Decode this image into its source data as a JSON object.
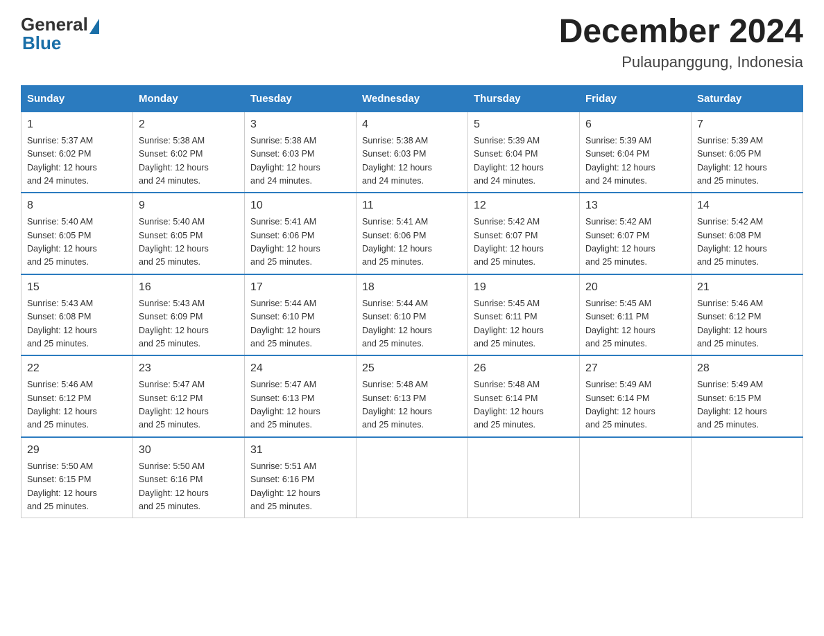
{
  "header": {
    "logo_general": "General",
    "logo_blue": "Blue",
    "month_title": "December 2024",
    "location": "Pulaupanggung, Indonesia"
  },
  "days_of_week": [
    "Sunday",
    "Monday",
    "Tuesday",
    "Wednesday",
    "Thursday",
    "Friday",
    "Saturday"
  ],
  "weeks": [
    [
      {
        "day": "1",
        "sunrise": "5:37 AM",
        "sunset": "6:02 PM",
        "daylight": "12 hours and 24 minutes."
      },
      {
        "day": "2",
        "sunrise": "5:38 AM",
        "sunset": "6:02 PM",
        "daylight": "12 hours and 24 minutes."
      },
      {
        "day": "3",
        "sunrise": "5:38 AM",
        "sunset": "6:03 PM",
        "daylight": "12 hours and 24 minutes."
      },
      {
        "day": "4",
        "sunrise": "5:38 AM",
        "sunset": "6:03 PM",
        "daylight": "12 hours and 24 minutes."
      },
      {
        "day": "5",
        "sunrise": "5:39 AM",
        "sunset": "6:04 PM",
        "daylight": "12 hours and 24 minutes."
      },
      {
        "day": "6",
        "sunrise": "5:39 AM",
        "sunset": "6:04 PM",
        "daylight": "12 hours and 24 minutes."
      },
      {
        "day": "7",
        "sunrise": "5:39 AM",
        "sunset": "6:05 PM",
        "daylight": "12 hours and 25 minutes."
      }
    ],
    [
      {
        "day": "8",
        "sunrise": "5:40 AM",
        "sunset": "6:05 PM",
        "daylight": "12 hours and 25 minutes."
      },
      {
        "day": "9",
        "sunrise": "5:40 AM",
        "sunset": "6:05 PM",
        "daylight": "12 hours and 25 minutes."
      },
      {
        "day": "10",
        "sunrise": "5:41 AM",
        "sunset": "6:06 PM",
        "daylight": "12 hours and 25 minutes."
      },
      {
        "day": "11",
        "sunrise": "5:41 AM",
        "sunset": "6:06 PM",
        "daylight": "12 hours and 25 minutes."
      },
      {
        "day": "12",
        "sunrise": "5:42 AM",
        "sunset": "6:07 PM",
        "daylight": "12 hours and 25 minutes."
      },
      {
        "day": "13",
        "sunrise": "5:42 AM",
        "sunset": "6:07 PM",
        "daylight": "12 hours and 25 minutes."
      },
      {
        "day": "14",
        "sunrise": "5:42 AM",
        "sunset": "6:08 PM",
        "daylight": "12 hours and 25 minutes."
      }
    ],
    [
      {
        "day": "15",
        "sunrise": "5:43 AM",
        "sunset": "6:08 PM",
        "daylight": "12 hours and 25 minutes."
      },
      {
        "day": "16",
        "sunrise": "5:43 AM",
        "sunset": "6:09 PM",
        "daylight": "12 hours and 25 minutes."
      },
      {
        "day": "17",
        "sunrise": "5:44 AM",
        "sunset": "6:10 PM",
        "daylight": "12 hours and 25 minutes."
      },
      {
        "day": "18",
        "sunrise": "5:44 AM",
        "sunset": "6:10 PM",
        "daylight": "12 hours and 25 minutes."
      },
      {
        "day": "19",
        "sunrise": "5:45 AM",
        "sunset": "6:11 PM",
        "daylight": "12 hours and 25 minutes."
      },
      {
        "day": "20",
        "sunrise": "5:45 AM",
        "sunset": "6:11 PM",
        "daylight": "12 hours and 25 minutes."
      },
      {
        "day": "21",
        "sunrise": "5:46 AM",
        "sunset": "6:12 PM",
        "daylight": "12 hours and 25 minutes."
      }
    ],
    [
      {
        "day": "22",
        "sunrise": "5:46 AM",
        "sunset": "6:12 PM",
        "daylight": "12 hours and 25 minutes."
      },
      {
        "day": "23",
        "sunrise": "5:47 AM",
        "sunset": "6:12 PM",
        "daylight": "12 hours and 25 minutes."
      },
      {
        "day": "24",
        "sunrise": "5:47 AM",
        "sunset": "6:13 PM",
        "daylight": "12 hours and 25 minutes."
      },
      {
        "day": "25",
        "sunrise": "5:48 AM",
        "sunset": "6:13 PM",
        "daylight": "12 hours and 25 minutes."
      },
      {
        "day": "26",
        "sunrise": "5:48 AM",
        "sunset": "6:14 PM",
        "daylight": "12 hours and 25 minutes."
      },
      {
        "day": "27",
        "sunrise": "5:49 AM",
        "sunset": "6:14 PM",
        "daylight": "12 hours and 25 minutes."
      },
      {
        "day": "28",
        "sunrise": "5:49 AM",
        "sunset": "6:15 PM",
        "daylight": "12 hours and 25 minutes."
      }
    ],
    [
      {
        "day": "29",
        "sunrise": "5:50 AM",
        "sunset": "6:15 PM",
        "daylight": "12 hours and 25 minutes."
      },
      {
        "day": "30",
        "sunrise": "5:50 AM",
        "sunset": "6:16 PM",
        "daylight": "12 hours and 25 minutes."
      },
      {
        "day": "31",
        "sunrise": "5:51 AM",
        "sunset": "6:16 PM",
        "daylight": "12 hours and 25 minutes."
      },
      null,
      null,
      null,
      null
    ]
  ],
  "labels": {
    "sunrise": "Sunrise:",
    "sunset": "Sunset:",
    "daylight": "Daylight:"
  }
}
